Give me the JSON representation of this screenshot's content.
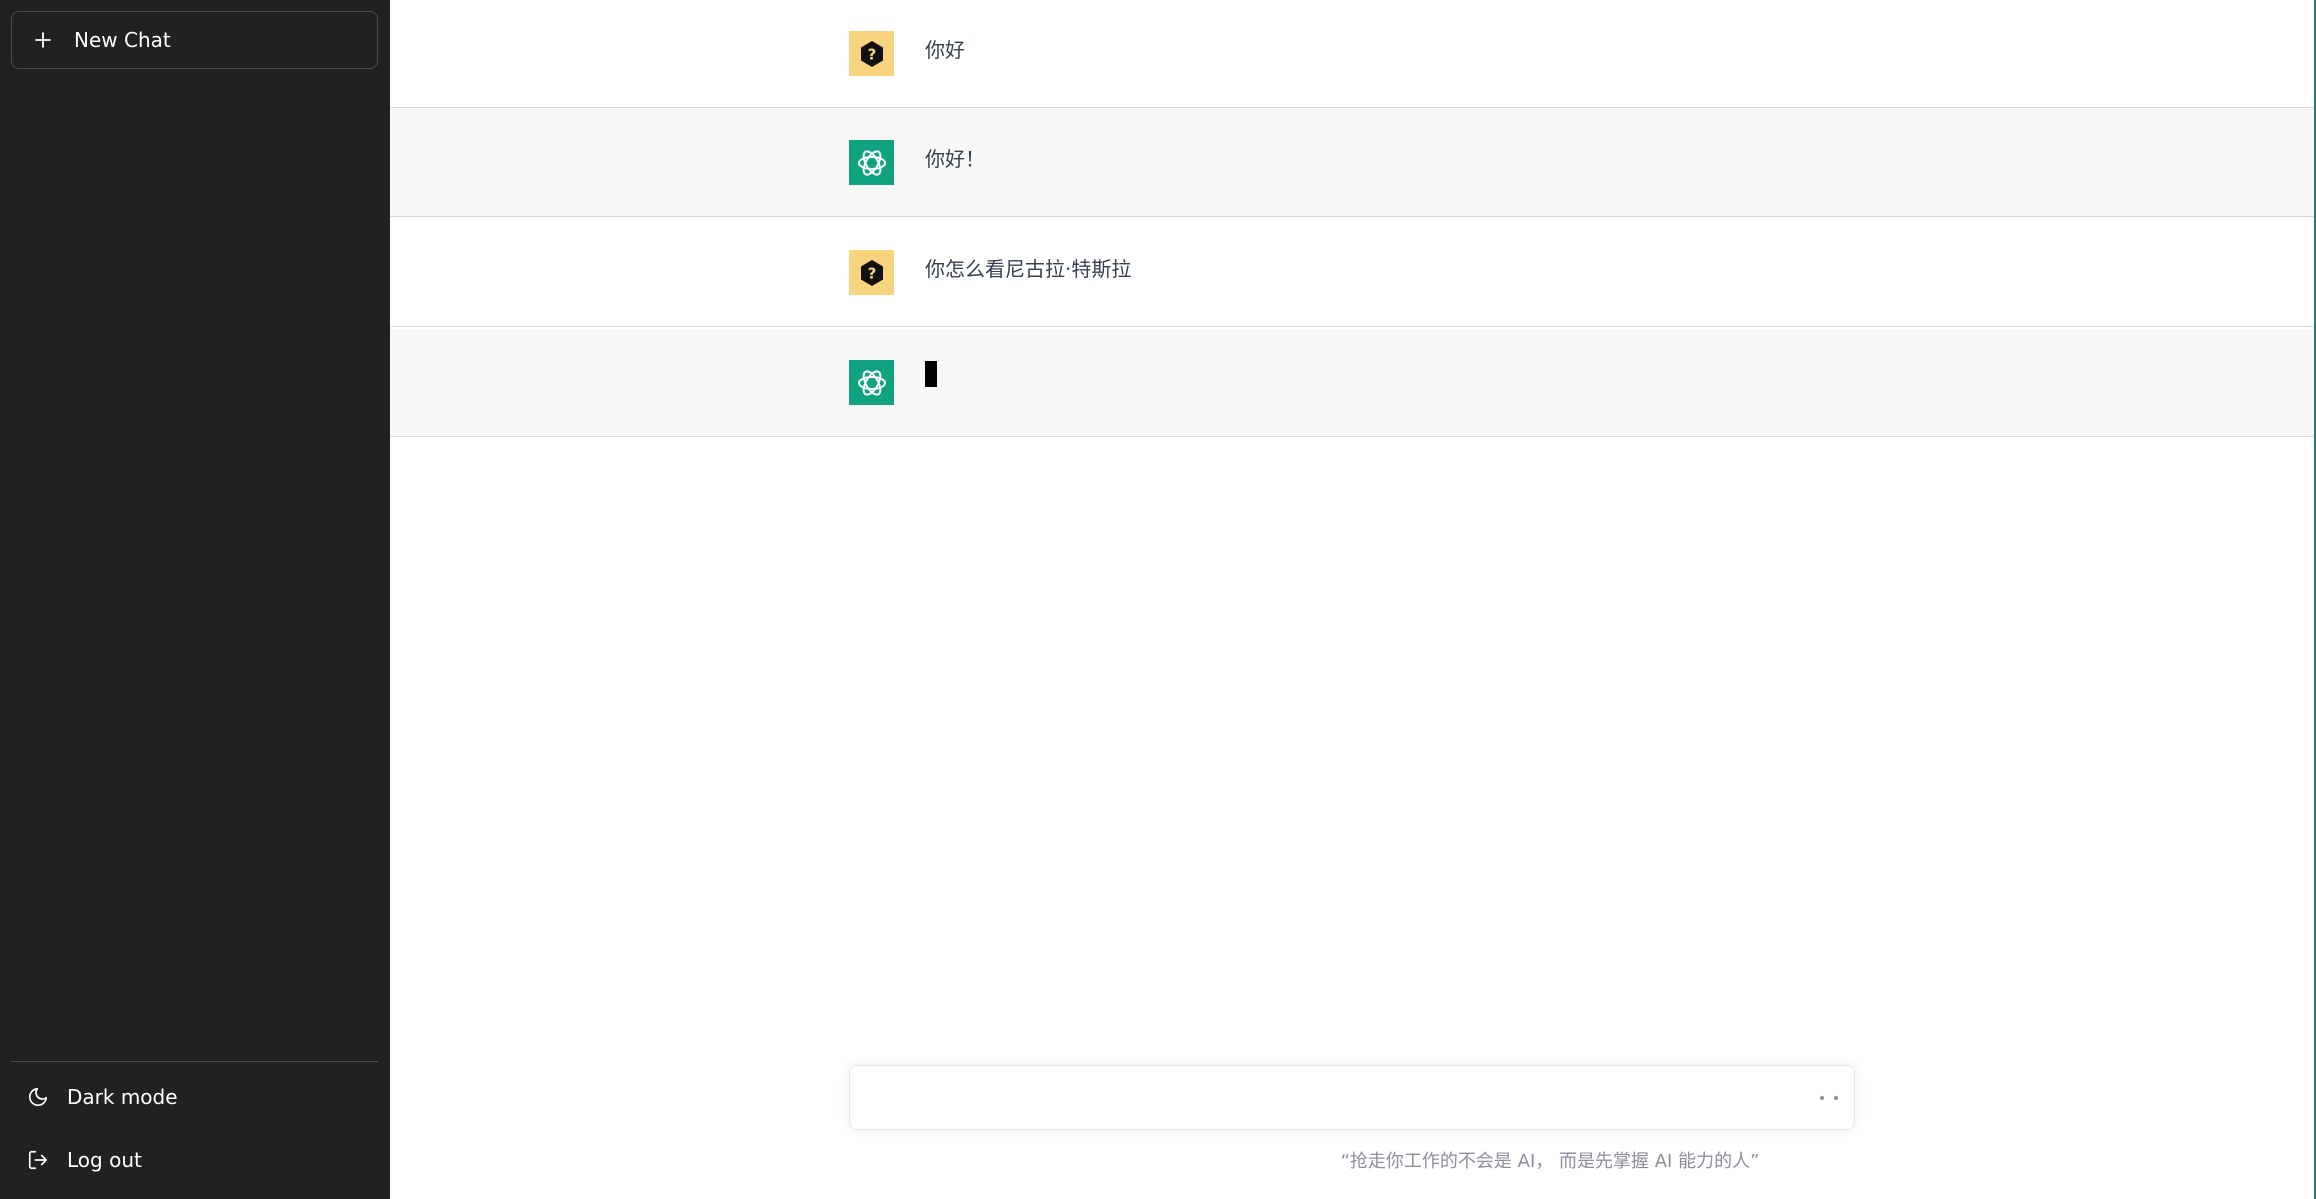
{
  "sidebar": {
    "new_chat_label": "New Chat",
    "bottom_items": [
      {
        "label": "Dark mode",
        "icon": "moon-icon"
      },
      {
        "label": "Log out",
        "icon": "logout-icon"
      }
    ]
  },
  "conversation": [
    {
      "role": "user",
      "text": "你好",
      "avatar_icon": "user-avatar-icon"
    },
    {
      "role": "assistant",
      "text": "你好！",
      "avatar_icon": "openai-logo-icon"
    },
    {
      "role": "user",
      "text": "你怎么看尼古拉·特斯拉",
      "avatar_icon": "user-avatar-icon"
    },
    {
      "role": "assistant",
      "text": "",
      "avatar_icon": "openai-logo-icon",
      "streaming": true
    }
  ],
  "input": {
    "value": "",
    "placeholder": ""
  },
  "footer": {
    "quote": "“抢走你工作的不会是 AI， 而是先掌握 AI 能力的人”"
  },
  "colors": {
    "sidebar_bg": "#202123",
    "assistant_row_bg": "#f7f7f8",
    "user_avatar_bg": "#f8d47f",
    "bot_avatar_bg": "#10a37f"
  }
}
